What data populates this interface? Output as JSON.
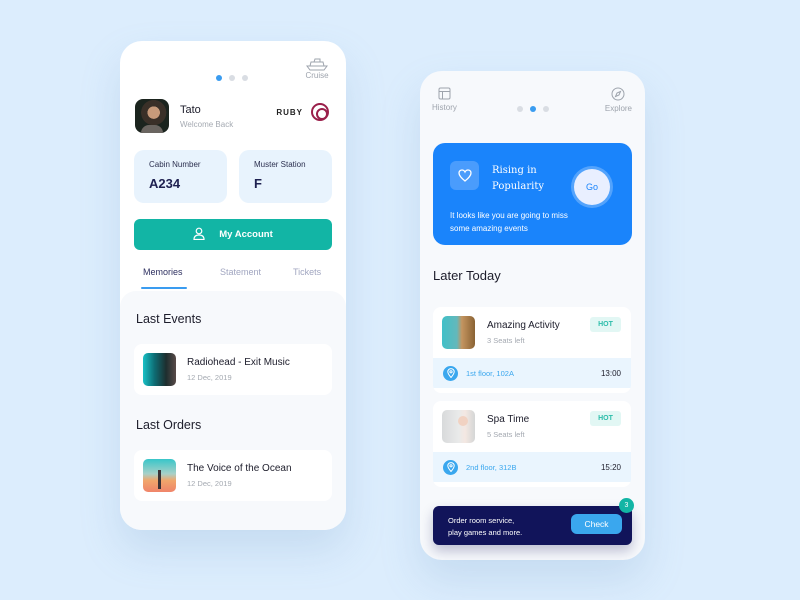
{
  "left_screen": {
    "pager": {
      "count": 3,
      "active_index": 0
    },
    "cruise": {
      "icon": "ship-icon",
      "label": "Cruise"
    },
    "profile": {
      "name": "Tato",
      "subtitle": "Welcome Back"
    },
    "brand": {
      "text": "RUBY",
      "logo": "ruby-logo-icon"
    },
    "info_cards": [
      {
        "label": "Cabin Number",
        "value": "A234"
      },
      {
        "label": "Muster Station",
        "value": "F"
      }
    ],
    "account_button": {
      "icon": "user-icon",
      "label": "My Account"
    },
    "tabs": [
      {
        "label": "Memories",
        "active": true
      },
      {
        "label": "Statement",
        "active": false
      },
      {
        "label": "Tickets",
        "active": false
      }
    ],
    "last_events": {
      "title": "Last Events",
      "items": [
        {
          "title": "Radiohead - Exit Music",
          "date": "12 Dec, 2019"
        }
      ]
    },
    "last_orders": {
      "title": "Last Orders",
      "items": [
        {
          "title": "The Voice of the Ocean",
          "date": "12 Dec, 2019"
        }
      ]
    }
  },
  "right_screen": {
    "nav": {
      "left": {
        "icon": "history-icon",
        "label": "History"
      },
      "right": {
        "icon": "compass-icon",
        "label": "Explore"
      }
    },
    "pager": {
      "count": 3,
      "active_index": 1
    },
    "promo": {
      "icon": "heart-icon",
      "title": "Rising in Popularity",
      "description": "It looks like you are going to miss some amazing events",
      "button_label": "Go",
      "color": "#1a84fb"
    },
    "later_today": {
      "title": "Later Today",
      "items": [
        {
          "title": "Amazing Activity",
          "subtitle": "3 Seats left",
          "badge": "HOT",
          "location": "1st floor, 102A",
          "time": "13:00"
        },
        {
          "title": "Spa Time",
          "subtitle": "5 Seats left",
          "badge": "HOT",
          "location": "2nd floor, 312B",
          "time": "15:20"
        }
      ]
    },
    "cta": {
      "text_line1": "Order room service,",
      "text_line2": "play games and more.",
      "button_label": "Check",
      "badge_count": "3"
    }
  },
  "colors": {
    "background": "#dcedfd",
    "accent_blue": "#3a9cf0",
    "teal": "#12b5a5",
    "navy": "#11145a"
  }
}
